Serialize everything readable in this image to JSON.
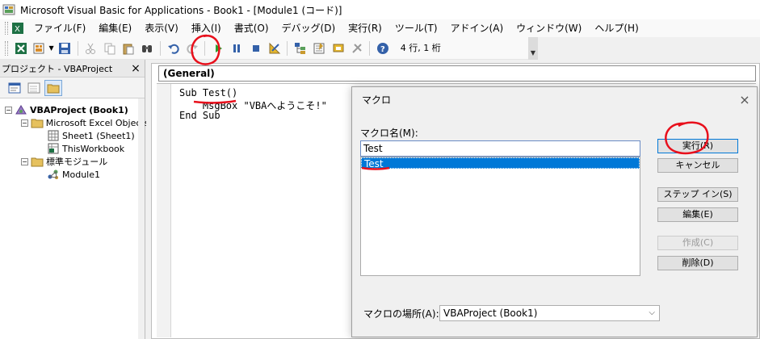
{
  "window": {
    "title": "Microsoft Visual Basic for Applications - Book1 - [Module1 (コード)]"
  },
  "menu": {
    "items": [
      "ファイル(F)",
      "編集(E)",
      "表示(V)",
      "挿入(I)",
      "書式(O)",
      "デバッグ(D)",
      "実行(R)",
      "ツール(T)",
      "アドイン(A)",
      "ウィンドウ(W)",
      "ヘルプ(H)"
    ]
  },
  "toolbar": {
    "status": "4 行, 1 桁"
  },
  "project": {
    "title": "プロジェクト - VBAProject",
    "close": "×",
    "tree": {
      "root": "VBAProject (Book1)",
      "excel_objects": "Microsoft Excel Objects",
      "sheet1": "Sheet1 (Sheet1)",
      "workbook": "ThisWorkbook",
      "modules": "標準モジュール",
      "module1": "Module1"
    }
  },
  "code": {
    "object_combo": "(General)",
    "lines": [
      "Sub Test()",
      "    MsgBox \"VBAへようこそ!\"",
      "End Sub"
    ]
  },
  "dialog": {
    "title": "マクロ",
    "close": "×",
    "name_label": "マクロ名(M):",
    "name_value": "Test",
    "list": [
      "Test"
    ],
    "buttons": {
      "run": "実行(R)",
      "cancel": "キャンセル",
      "step_into": "ステップ イン(S)",
      "edit": "編集(E)",
      "create": "作成(C)",
      "delete": "削除(D)"
    },
    "location_label": "マクロの場所(A):",
    "location_value": "VBAProject (Book1)"
  },
  "colors": {
    "selection": "#0078d7",
    "annotation": "#e8101c",
    "run_icon": "#2e9e2e"
  }
}
